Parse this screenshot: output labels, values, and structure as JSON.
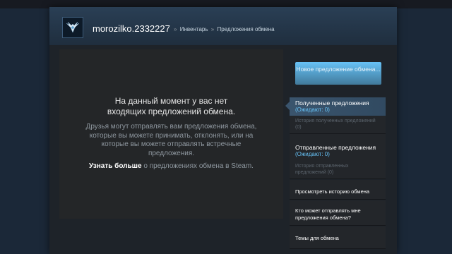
{
  "header": {
    "username": "morozilko.2332227",
    "breadcrumb": [
      "Инвентарь",
      "Предложения обмена"
    ],
    "separator": "»"
  },
  "main": {
    "title": "На данный момент у вас нет входящих предложений обмена.",
    "description": "Друзья могут отправлять вам предложения обмена, которые вы можете принимать, отклонять, или на которые вы можете отправлять встречные предложения.",
    "learn_bold": "Узнать больше",
    "learn_rest": "о предложениях обмена в Steam."
  },
  "sidebar": {
    "new_offer_label": "Новое предложение обмена...",
    "received": {
      "title": "Полученные предложения",
      "pending": "(Ожидают: 0)",
      "history": "История полученных предложений (0)"
    },
    "sent": {
      "title": "Отправленные предложения",
      "pending": "(Ожидают: 0)",
      "history": "История отправленных предложений (0)"
    },
    "links": [
      "Просмотреть историю обмена",
      "Кто может отправлять мне предложения обмена?",
      "Темы для обмена"
    ]
  }
}
